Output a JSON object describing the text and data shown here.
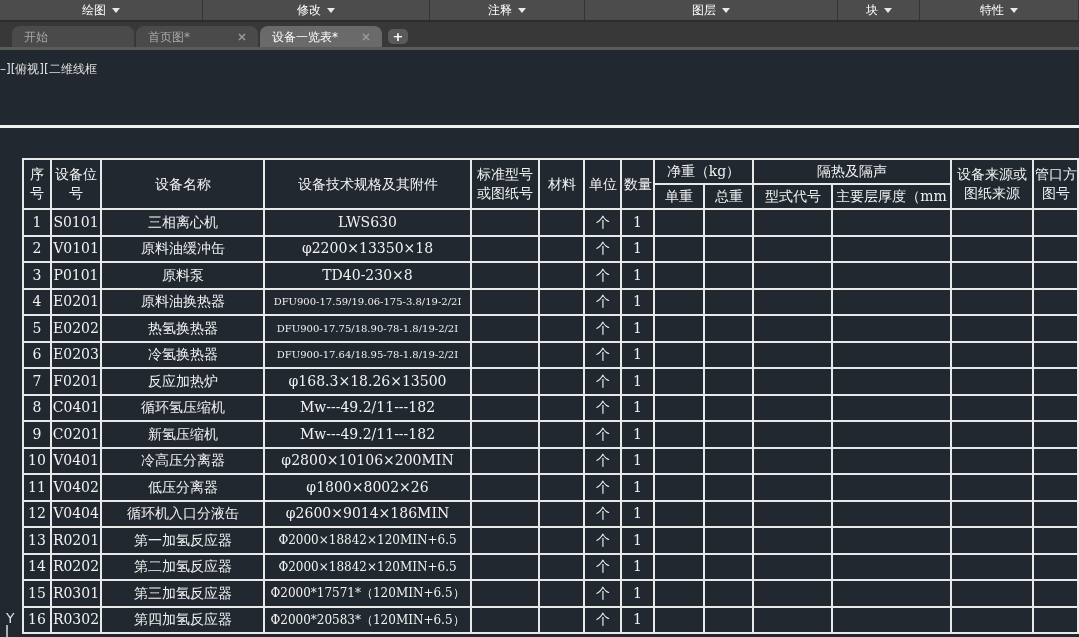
{
  "ribbon_panels": [
    "绘图",
    "修改",
    "注释",
    "图层",
    "块",
    "特性"
  ],
  "tabs": [
    {
      "label": "开始",
      "selected": false,
      "closable": false
    },
    {
      "label": "首页图*",
      "selected": false,
      "closable": true
    },
    {
      "label": "设备一览表*",
      "selected": true,
      "closable": true
    }
  ],
  "new_tab": "+",
  "viewport_label": "–][俯视][二维线框",
  "ucs_label": "Y",
  "table": {
    "columns": [
      {
        "label": "序号"
      },
      {
        "label": "设备位号"
      },
      {
        "label": "设备名称"
      },
      {
        "label": "设备技术规格及其附件"
      },
      {
        "label": "标准型号或图纸号"
      },
      {
        "label": "材料"
      },
      {
        "label": "单位"
      },
      {
        "label": "数量"
      },
      {
        "label": "净重（kg）",
        "children": [
          "单重",
          "总重"
        ]
      },
      {
        "label": "隔热及隔声",
        "children": [
          "型式代号",
          "主要层厚度（mm"
        ]
      },
      {
        "label": "设备来源或图纸来源"
      },
      {
        "label": "管口方图号"
      }
    ],
    "rows": [
      [
        "1",
        "S0101",
        "三相离心机",
        "LWS630",
        "",
        "",
        "个",
        "1"
      ],
      [
        "2",
        "V0101",
        "原料油缓冲缶",
        "φ2200×13350×18",
        "",
        "",
        "个",
        "1"
      ],
      [
        "3",
        "P0101",
        "原料泵",
        "TD40-230×8",
        "",
        "",
        "个",
        "1"
      ],
      [
        "4",
        "E0201",
        "原料油换热器",
        "DFU900-17.59/19.06-175-3.8/19-2/2Ⅰ",
        "",
        "",
        "个",
        "1"
      ],
      [
        "5",
        "E0202",
        "热氢换热器",
        "DFU900-17.75/18.90-78-1.8/19-2/2I",
        "",
        "",
        "个",
        "1"
      ],
      [
        "6",
        "E0203",
        "冷氢换热器",
        "DFU900-17.64/18.95-78-1.8/19-2/2I",
        "",
        "",
        "个",
        "1"
      ],
      [
        "7",
        "F0201",
        "反应加热炉",
        "φ168.3×18.26×13500",
        "",
        "",
        "个",
        "1"
      ],
      [
        "8",
        "C0401",
        "循环氢压缩机",
        "Mw---49.2/11---182",
        "",
        "",
        "个",
        "1"
      ],
      [
        "9",
        "C0201",
        "新氢压缩机",
        "Mw---49.2/11---182",
        "",
        "",
        "个",
        "1"
      ],
      [
        "10",
        "V0401",
        "冷高压分离器",
        "φ2800×10106×200MIN",
        "",
        "",
        "个",
        "1"
      ],
      [
        "11",
        "V0402",
        "低压分离器",
        "φ1800×8002×26",
        "",
        "",
        "个",
        "1"
      ],
      [
        "12",
        "V0404",
        "循环机入口分液缶",
        "φ2600×9014×186MIN",
        "",
        "",
        "个",
        "1"
      ],
      [
        "13",
        "R0201",
        "第一加氢反应器",
        "Φ2000×18842×120MIN+6.5",
        "",
        "",
        "个",
        "1"
      ],
      [
        "14",
        "R0202",
        "第二加氢反应器",
        "Φ2000×18842×120MIN+6.5",
        "",
        "",
        "个",
        "1"
      ],
      [
        "15",
        "R0301",
        "第三加氢反应器",
        "Φ2000*17571*（120MIN+6.5）",
        "",
        "",
        "个",
        "1"
      ],
      [
        "16",
        "R0302",
        "第四加氢反应器",
        "Φ2000*20583*（120MIN+6.5）",
        "",
        "",
        "个",
        "1"
      ]
    ]
  }
}
